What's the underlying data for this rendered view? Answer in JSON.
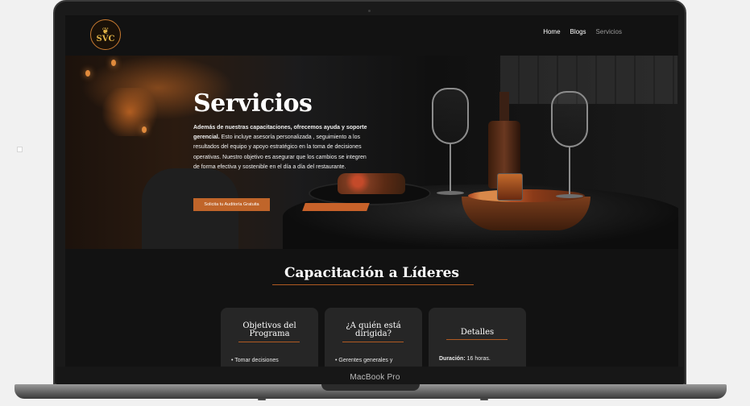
{
  "device": {
    "label": "MacBook Pro"
  },
  "site": {
    "logo": {
      "text": "SVC",
      "icon": "pineapple-icon"
    },
    "nav": [
      {
        "label": "Home",
        "active": false
      },
      {
        "label": "Blogs",
        "active": false
      },
      {
        "label": "Servicios",
        "active": true
      }
    ]
  },
  "hero": {
    "title": "Servicios",
    "body_bold": "Además de nuestras capacitaciones, ofrecemos ayuda y soporte gerencial.",
    "body_rest": " Esto incluye asesoría personalizada , seguimiento a los resultados del equipo y apoyo estratégico en la toma de decisiones operativas. Nuestro objetivo es asegurar que los cambios se integren de forma efectiva y sostenible en el día a día del restaurante.",
    "cta_label": "Solicita tu Auditoría Gratuita"
  },
  "section": {
    "title": "Capacitación a Líderes",
    "cards": [
      {
        "title": "Objetivos del Programa",
        "text": "• Tomar decisiones"
      },
      {
        "title": "¿A quién está dirigida?",
        "text": "• Gerentes generales y"
      },
      {
        "title": "Detalles",
        "label": "Duración:",
        "value": " 16 horas."
      }
    ]
  },
  "colors": {
    "accent": "#c0652a",
    "background": "#121212",
    "card": "#262626"
  }
}
